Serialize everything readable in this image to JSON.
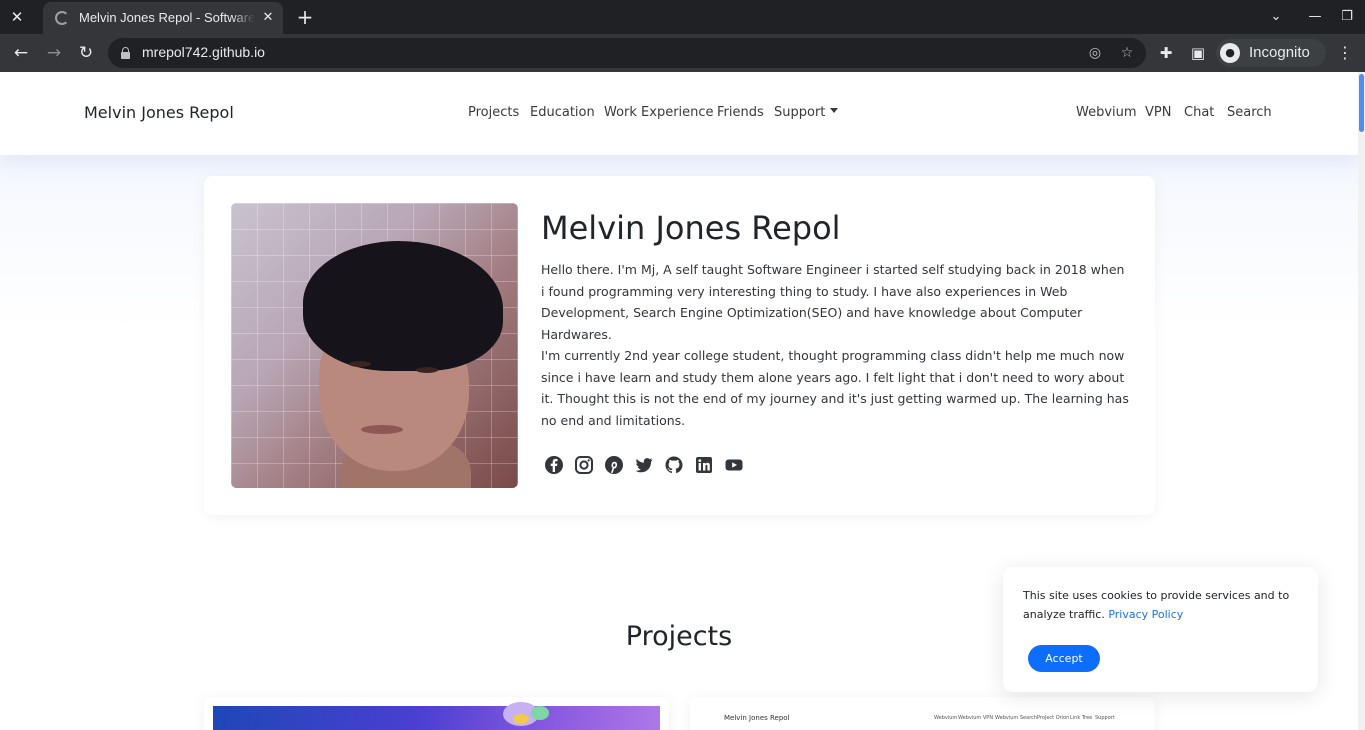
{
  "browser": {
    "tab_title": "Melvin Jones Repol - Software Engineer",
    "url": "mrepol742.github.io",
    "profile_label": "Incognito",
    "icons": {
      "close_window": "close-icon",
      "new_tab": "plus-icon",
      "back": "arrow-left-icon",
      "forward": "arrow-right-icon",
      "reload": "reload-icon",
      "lock": "lock-icon",
      "tracking": "eye-off-icon",
      "bookmark": "star-icon",
      "extensions": "puzzle-icon",
      "side_panel": "side-panel-icon",
      "menu": "kebab-menu-icon"
    }
  },
  "navbar": {
    "brand": "Melvin Jones Repol",
    "links": [
      "Projects",
      "Education",
      "Work Experience",
      "Friends",
      "Support"
    ],
    "right_links": [
      "Webvium",
      "VPN",
      "Chat",
      "Search"
    ]
  },
  "hero": {
    "name": "Melvin Jones Repol",
    "paragraph1": "Hello there. I'm Mj, A self taught Software Engineer i started self studying back in 2018 when i found programming very interesting thing to study. I have also experiences in Web Development, Search Engine Optimization(SEO) and have knowledge about Computer Hardwares.",
    "paragraph2": "I'm currently 2nd year college student, thought programming class didn't help me much now since i have learn and study them alone years ago. I felt light that i don't need to wory about it. Thought this is not the end of my journey and it's just getting warmed up. The learning has no end and limitations.",
    "socials": [
      "facebook-icon",
      "instagram-icon",
      "pinterest-icon",
      "twitter-icon",
      "github-icon",
      "linkedin-icon",
      "youtube-icon"
    ]
  },
  "projects": {
    "title": "Projects",
    "preview2": {
      "brand": "Melvin Jones Repol",
      "links": [
        "Webvium",
        "Webvium VPN",
        "Webvium Search",
        "Project Orion",
        "Link Tree",
        "Support"
      ]
    }
  },
  "cookie": {
    "text": "This site uses cookies to provide services and to analyze traffic.",
    "link": "Privacy Policy",
    "accept": "Accept"
  },
  "colors": {
    "accent": "#0d6efd",
    "chrome_dark": "#202124",
    "chrome_tab": "#35363a"
  }
}
